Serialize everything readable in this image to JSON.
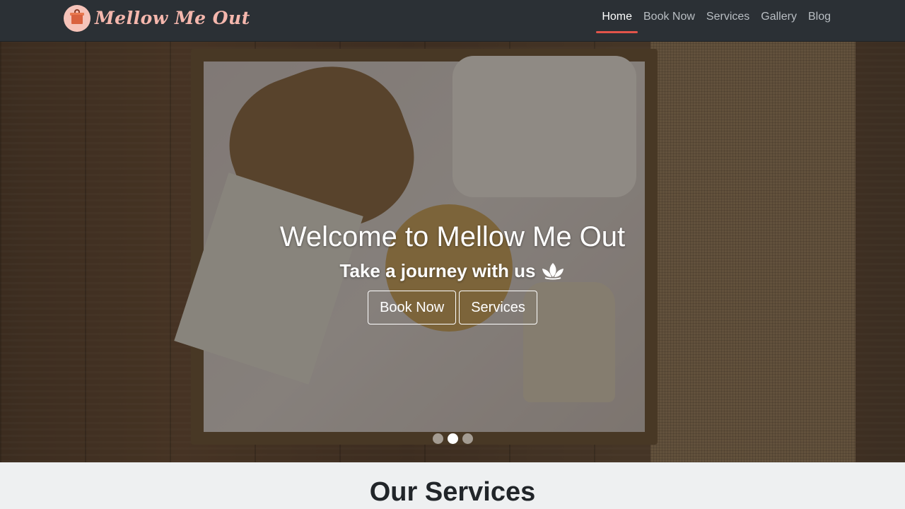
{
  "brand": {
    "name": "Mellow Me Out",
    "logo_colors": {
      "circle": "#f6c3b9",
      "box": "#d9623f"
    }
  },
  "nav": {
    "items": [
      {
        "label": "Home",
        "active": true
      },
      {
        "label": "Book Now",
        "active": false
      },
      {
        "label": "Services",
        "active": false
      },
      {
        "label": "Gallery",
        "active": false
      },
      {
        "label": "Blog",
        "active": false
      }
    ],
    "active_color": "#e2544a"
  },
  "hero": {
    "title": "Welcome to Mellow Me Out",
    "subtitle": "Take a journey with us",
    "subtitle_icon": "lotus-icon",
    "buttons": [
      {
        "label": "Book Now"
      },
      {
        "label": "Services"
      }
    ],
    "carousel": {
      "total_slides": 3,
      "active_index": 1
    }
  },
  "section": {
    "title": "Our Services"
  }
}
